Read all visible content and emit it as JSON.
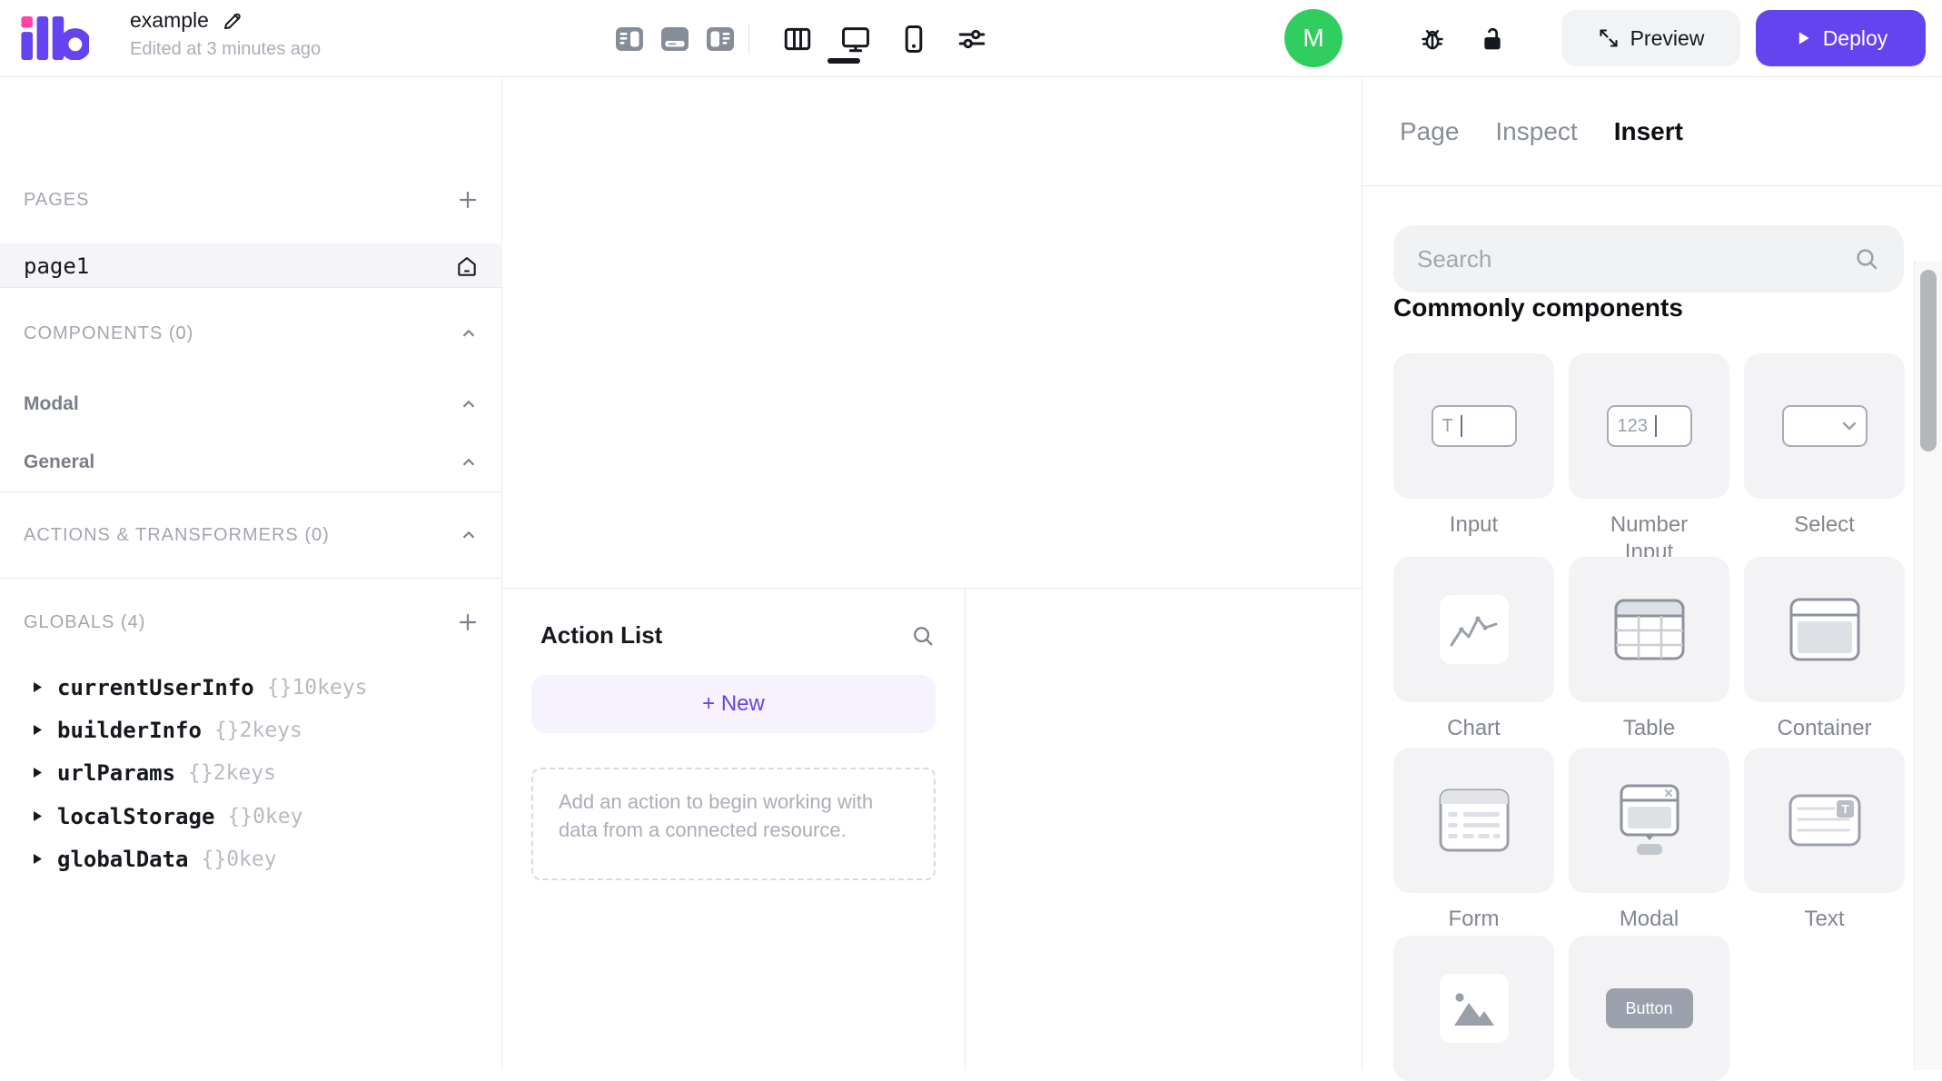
{
  "colors": {
    "accent_purple": "#6344ee",
    "brand_pink": "#ff44aa",
    "avatar_green": "#2fce5f"
  },
  "topbar": {
    "app_title": "example",
    "edited_status": "Edited at 3 minutes ago",
    "avatar_initial": "M",
    "preview_label": "Preview",
    "deploy_label": "Deploy"
  },
  "sidebar": {
    "pages_header": "PAGES",
    "page_item": "page1",
    "components_header": "COMPONENTS (0)",
    "component_groups": [
      {
        "label": "Modal"
      },
      {
        "label": "General"
      }
    ],
    "actions_header": "ACTIONS & TRANSFORMERS (0)",
    "globals_header": "GLOBALS (4)",
    "globals": [
      {
        "name": "currentUserInfo",
        "meta": "{}10keys"
      },
      {
        "name": "builderInfo",
        "meta": "{}2keys"
      },
      {
        "name": "urlParams",
        "meta": "{}2keys"
      },
      {
        "name": "localStorage",
        "meta": "{}0key"
      },
      {
        "name": "globalData",
        "meta": "{}0key"
      }
    ]
  },
  "action_panel": {
    "title": "Action List",
    "new_button_label": "+ New",
    "empty_message": "Add an action to begin working with data from a connected resource."
  },
  "right_panel": {
    "tabs": [
      {
        "label": "Page"
      },
      {
        "label": "Inspect"
      },
      {
        "label": "Insert"
      }
    ],
    "active_tab": "Insert",
    "search_placeholder": "Search",
    "section_title": "Commonly components",
    "components": [
      {
        "label": "Input",
        "preview": "T"
      },
      {
        "label": "Number Input",
        "preview": "123"
      },
      {
        "label": "Select"
      },
      {
        "label": "Chart"
      },
      {
        "label": "Table"
      },
      {
        "label": "Container"
      },
      {
        "label": "Form"
      },
      {
        "label": "Modal"
      },
      {
        "label": "Text",
        "badge": "T"
      },
      {
        "label": ""
      },
      {
        "label": "",
        "preview": "Button"
      }
    ]
  }
}
